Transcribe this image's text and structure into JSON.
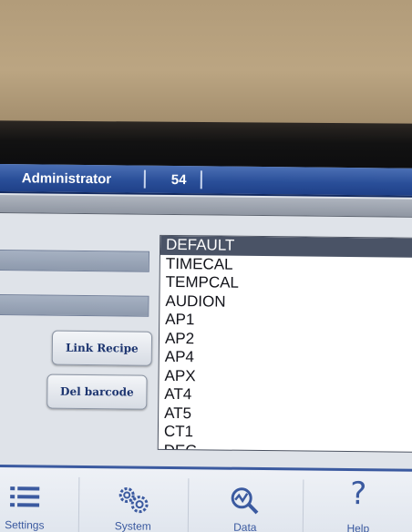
{
  "header": {
    "user": "Administrator",
    "number": "54"
  },
  "buttons": {
    "link_recipe": "Link Recipe",
    "del_barcode": "Del barcode"
  },
  "recipe_list": {
    "selected": "DEFAULT",
    "items": [
      "DEFAULT",
      "TIMECAL",
      "TEMPCAL",
      "AUDION",
      "AP1",
      "AP2",
      "AP4",
      "APX",
      "AT4",
      "AT5",
      "CT1",
      "DEG"
    ]
  },
  "nav": {
    "settings": {
      "label": "Settings",
      "icon": "list-icon"
    },
    "system": {
      "label": "System",
      "icon": "gears-icon"
    },
    "data": {
      "label": "Data",
      "icon": "graph-magnifier-icon"
    },
    "help": {
      "label": "Help",
      "icon": "question-icon"
    }
  },
  "colors": {
    "header": "#2a4f99",
    "accent": "#3b5aa0",
    "selection": "#4a5366"
  }
}
